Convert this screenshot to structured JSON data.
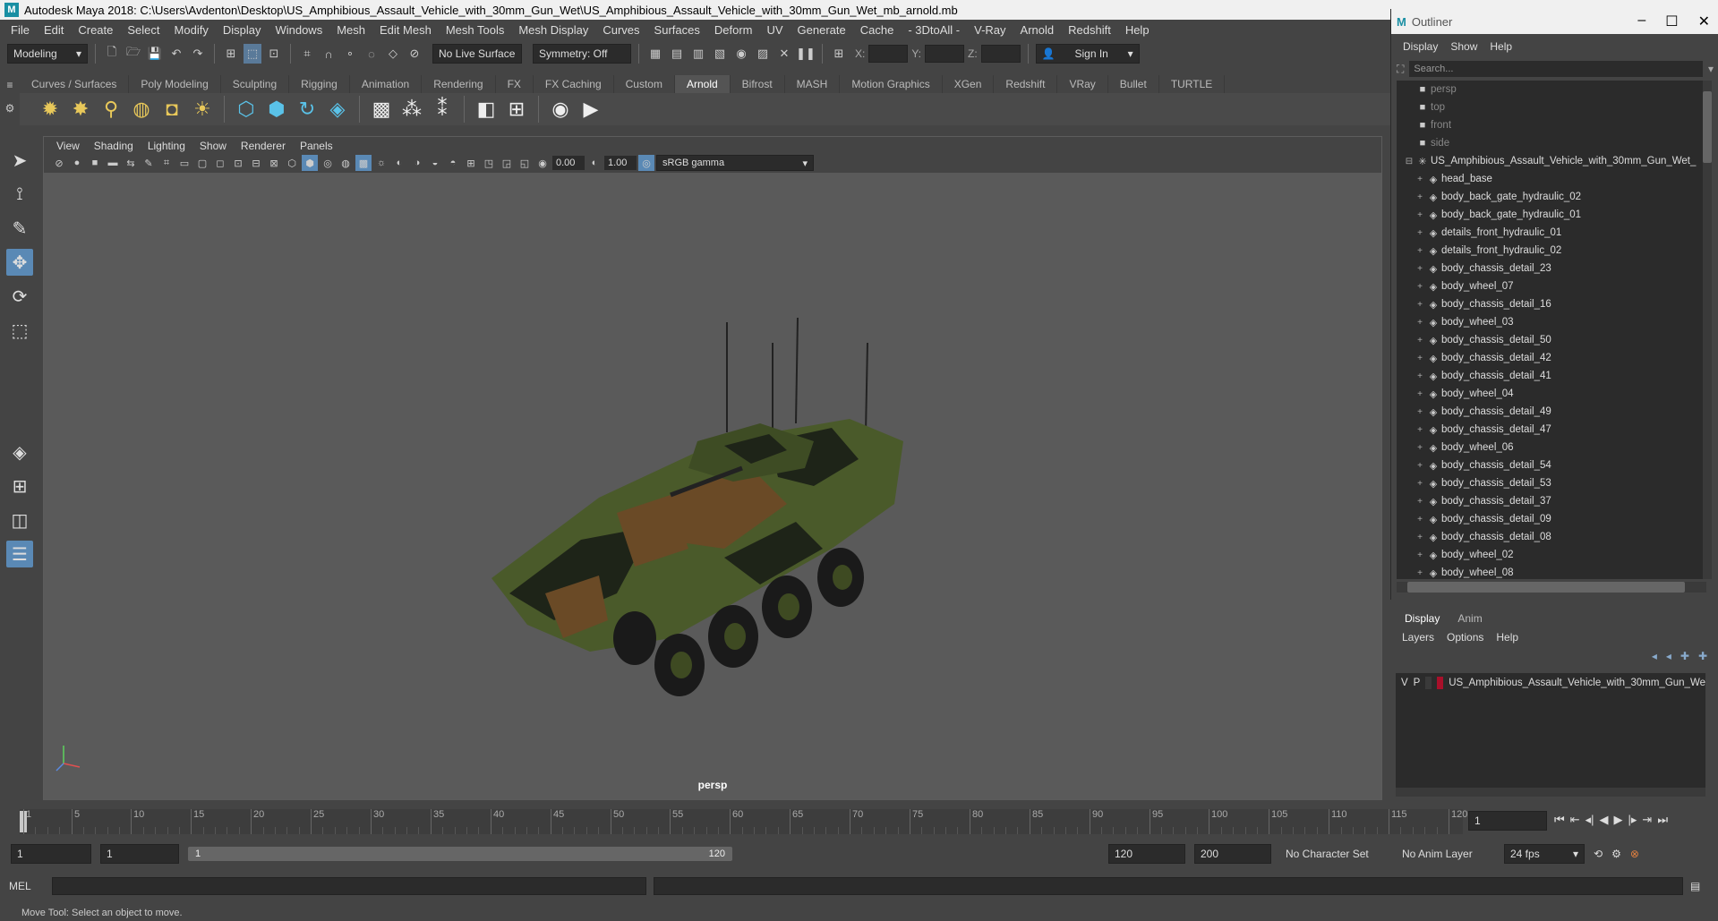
{
  "window": {
    "title": "Autodesk Maya 2018: C:\\Users\\Avdenton\\Desktop\\US_Amphibious_Assault_Vehicle_with_30mm_Gun_Wet\\US_Amphibious_Assault_Vehicle_with_30mm_Gun_Wet_mb_arnold.mb"
  },
  "menu": [
    "File",
    "Edit",
    "Create",
    "Select",
    "Modify",
    "Display",
    "Windows",
    "Mesh",
    "Edit Mesh",
    "Mesh Tools",
    "Mesh Display",
    "Curves",
    "Surfaces",
    "Deform",
    "UV",
    "Generate",
    "Cache",
    "- 3DtoAll -",
    "V-Ray",
    "Arnold",
    "Redshift",
    "Help"
  ],
  "statusline": {
    "mode": "Modeling",
    "live_surface": "No Live Surface",
    "symmetry": "Symmetry: Off",
    "x_label": "X:",
    "y_label": "Y:",
    "z_label": "Z:",
    "sign_in": "Sign In"
  },
  "shelf_tabs": [
    "Curves / Surfaces",
    "Poly Modeling",
    "Sculpting",
    "Rigging",
    "Animation",
    "Rendering",
    "FX",
    "FX Caching",
    "Custom",
    "Arnold",
    "Bifrost",
    "MASH",
    "Motion Graphics",
    "XGen",
    "Redshift",
    "VRay",
    "Bullet",
    "TURTLE"
  ],
  "active_shelf": "Arnold",
  "panel_menu": [
    "View",
    "Shading",
    "Lighting",
    "Show",
    "Renderer",
    "Panels"
  ],
  "panel_tools": {
    "exposure": "0.00",
    "gamma": "1.00",
    "color_space": "sRGB gamma"
  },
  "viewport": {
    "camera": "persp"
  },
  "outliner": {
    "title": "Outliner",
    "menu": [
      "Display",
      "Show",
      "Help"
    ],
    "search_placeholder": "Search...",
    "cameras": [
      "persp",
      "top",
      "front",
      "side"
    ],
    "root": "US_Amphibious_Assault_Vehicle_with_30mm_Gun_Wet_",
    "items": [
      "head_base",
      "body_back_gate_hydraulic_02",
      "body_back_gate_hydraulic_01",
      "details_front_hydraulic_01",
      "details_front_hydraulic_02",
      "body_chassis_detail_23",
      "body_wheel_07",
      "body_chassis_detail_16",
      "body_wheel_03",
      "body_chassis_detail_50",
      "body_chassis_detail_42",
      "body_chassis_detail_41",
      "body_wheel_04",
      "body_chassis_detail_49",
      "body_chassis_detail_47",
      "body_wheel_06",
      "body_chassis_detail_54",
      "body_chassis_detail_53",
      "body_chassis_detail_37",
      "body_chassis_detail_09",
      "body_chassis_detail_08",
      "body_wheel_02",
      "body_wheel_08"
    ]
  },
  "layers": {
    "tabs": [
      "Display",
      "Anim"
    ],
    "menu": [
      "Layers",
      "Options",
      "Help"
    ],
    "v": "V",
    "p": "P",
    "layer_name": "US_Amphibious_Assault_Vehicle_with_30mm_Gun_We",
    "layer_color": "#a8102a"
  },
  "timeline": {
    "ticks": [
      "1",
      "5",
      "10",
      "15",
      "20",
      "25",
      "30",
      "35",
      "40",
      "45",
      "50",
      "55",
      "60",
      "65",
      "70",
      "75",
      "80",
      "85",
      "90",
      "95",
      "100",
      "105",
      "110",
      "115",
      "120"
    ],
    "current_frame": "1"
  },
  "range": {
    "start": "1",
    "playback_start": "1",
    "slider_start": "1",
    "slider_end": "120",
    "playback_end": "120",
    "end": "200",
    "character_set": "No Character Set",
    "anim_layer": "No Anim Layer",
    "fps": "24 fps"
  },
  "cmd": {
    "label": "MEL"
  },
  "help_line": "Move Tool: Select an object to move.",
  "colors": {
    "accent": "#5a89b5",
    "camo_green": "#4a5a2a",
    "camo_brown": "#6a4a26",
    "camo_dark": "#1e2418"
  }
}
